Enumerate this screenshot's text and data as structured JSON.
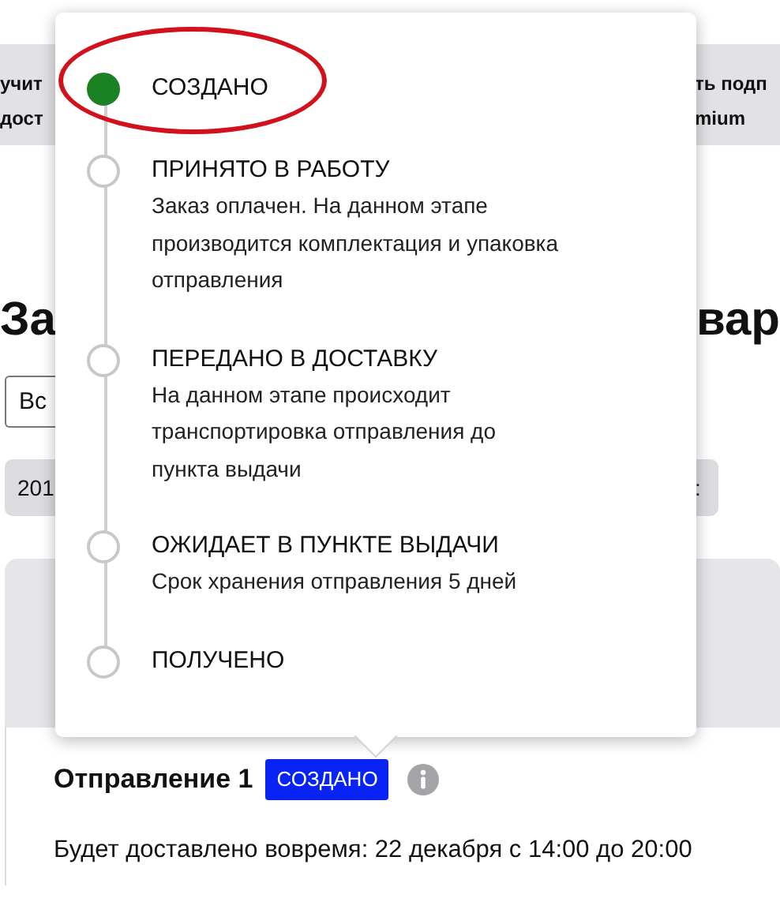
{
  "background": {
    "banner": {
      "left_lines": [
        "учит",
        "дост"
      ],
      "right_lines": [
        "ть подп",
        "mium"
      ]
    },
    "heading": {
      "left": "За",
      "right": "вар"
    },
    "select": {
      "value": "Вс"
    },
    "chips": [
      "201",
      ":"
    ]
  },
  "popover": {
    "steps": [
      {
        "title": "СОЗДАНО",
        "current": true,
        "circled": true
      },
      {
        "title": "ПРИНЯТО В РАБОТУ",
        "description_lines": [
          "Заказ оплачен. На данном этапе",
          "производится комплектация и упаковка",
          "отправления"
        ],
        "current": false,
        "circled": false
      },
      {
        "title": "ПЕРЕДАНО В ДОСТАВКУ",
        "description_lines": [
          "На данном этапе происходит",
          "транспортировка отправления до",
          "пункта выдачи"
        ],
        "current": false,
        "circled": false
      },
      {
        "title": "ОЖИДАЕТ В ПУНКТЕ ВЫДАЧИ",
        "description_lines": [
          "Срок хранения отправления 5 дней"
        ],
        "current": false,
        "circled": false
      },
      {
        "title": "ПОЛУЧЕНО",
        "current": false,
        "circled": false
      }
    ]
  },
  "shipment": {
    "title": "Отправление 1",
    "status": "СОЗДАНО",
    "delivery": "Будет доставлено вовремя: 22 декабря с 14:00 до 20:00"
  }
}
